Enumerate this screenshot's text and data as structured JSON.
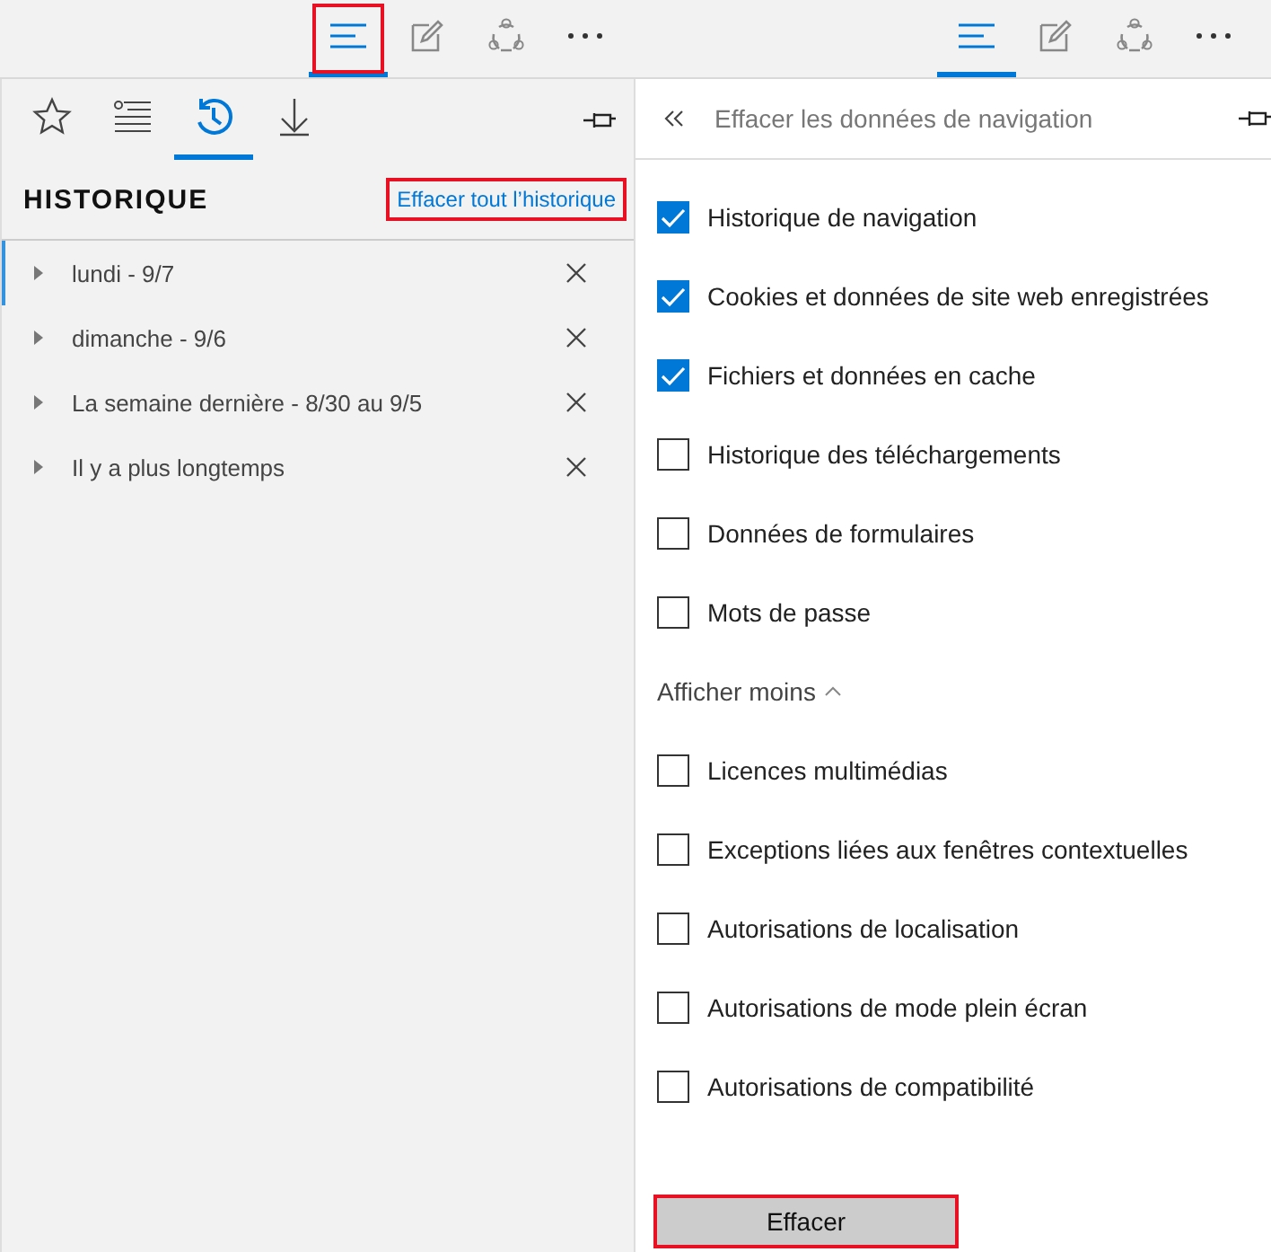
{
  "left": {
    "toolbar": [
      {
        "kind": "hub",
        "selected": true,
        "highlighted": true
      },
      {
        "kind": "note",
        "selected": false,
        "highlighted": false
      },
      {
        "kind": "share",
        "selected": false,
        "highlighted": false
      },
      {
        "kind": "more",
        "selected": false,
        "highlighted": false
      }
    ],
    "hub_tabs": [
      {
        "kind": "favorites",
        "selected": false
      },
      {
        "kind": "reading",
        "selected": false
      },
      {
        "kind": "history",
        "selected": true
      },
      {
        "kind": "downloads",
        "selected": false
      }
    ],
    "heading": "HISTORIQUE",
    "clear_all": {
      "label": "Effacer tout l’historique",
      "highlighted": true
    },
    "history_groups": [
      {
        "label": "lundi - 9/7",
        "selected": true
      },
      {
        "label": "dimanche - 9/6",
        "selected": false
      },
      {
        "label": "La semaine dernière - 8/30 au 9/5",
        "selected": false
      },
      {
        "label": "Il y a plus longtemps",
        "selected": false
      }
    ]
  },
  "right": {
    "toolbar": [
      {
        "kind": "hub",
        "selected": true,
        "highlighted": false
      },
      {
        "kind": "note",
        "selected": false,
        "highlighted": false
      },
      {
        "kind": "share",
        "selected": false,
        "highlighted": false
      },
      {
        "kind": "more",
        "selected": false,
        "highlighted": false
      }
    ],
    "panel_title": "Effacer les données de navigation",
    "options": [
      {
        "label": "Historique de navigation",
        "checked": true
      },
      {
        "label": "Cookies et données de site web enregistrées",
        "checked": true
      },
      {
        "label": "Fichiers et données en cache",
        "checked": true
      },
      {
        "label": "Historique des téléchargements",
        "checked": false
      },
      {
        "label": "Données de formulaires",
        "checked": false
      },
      {
        "label": "Mots de passe",
        "checked": false
      }
    ],
    "toggle": "Afficher moins",
    "more_options": [
      {
        "label": "Licences multimédias",
        "checked": false
      },
      {
        "label": "Exceptions liées aux fenêtres contextuelles",
        "checked": false
      },
      {
        "label": "Autorisations de localisation",
        "checked": false
      },
      {
        "label": "Autorisations de mode plein écran",
        "checked": false
      },
      {
        "label": "Autorisations de compatibilité",
        "checked": false
      }
    ],
    "button": {
      "label": "Effacer",
      "highlighted": true
    }
  }
}
